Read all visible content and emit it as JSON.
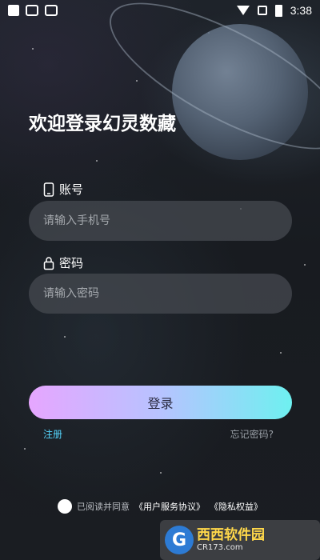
{
  "status_bar": {
    "time": "3:38"
  },
  "page": {
    "title": "欢迎登录幻灵数藏"
  },
  "account": {
    "label": "账号",
    "placeholder": "请输入手机号",
    "icon": "phone-icon"
  },
  "password": {
    "label": "密码",
    "placeholder": "请输入密码",
    "icon": "lock-icon"
  },
  "login_button": {
    "label": "登录"
  },
  "links": {
    "register": "注册",
    "forgot": "忘记密码?"
  },
  "agreement": {
    "prefix": "已阅读并同意",
    "user_agreement": "《用户服务协议》",
    "privacy": "《隐私权益》"
  },
  "watermark": {
    "logo_letter": "G",
    "brand": "西西软件园",
    "domain": "CR173.com"
  },
  "colors": {
    "accent_link": "#55d7ff",
    "button_gradient_start": "#e6a6ff",
    "button_gradient_end": "#6ef0f0"
  }
}
